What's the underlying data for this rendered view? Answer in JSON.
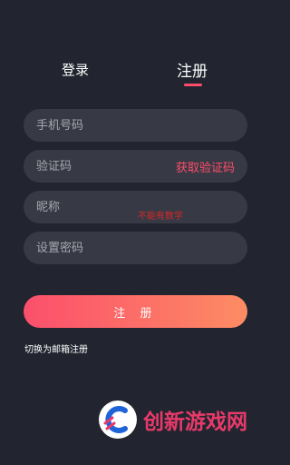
{
  "tabs": {
    "login": "登录",
    "register": "注册"
  },
  "form": {
    "phone_placeholder": "手机号码",
    "code_placeholder": "验证码",
    "get_code": "获取验证码",
    "nickname_placeholder": "昵称",
    "nickname_note": "不能有数字",
    "password_placeholder": "设置密码",
    "submit": "注 册",
    "switch_email": "切换为邮箱注册"
  },
  "watermark": {
    "text": "创新游戏网"
  },
  "colors": {
    "background": "#22252f",
    "field": "#373a45",
    "accent": "#ff4d6a",
    "note": "#d62828",
    "gradient_start": "#fb4f6c",
    "gradient_end": "#fd8c63"
  }
}
